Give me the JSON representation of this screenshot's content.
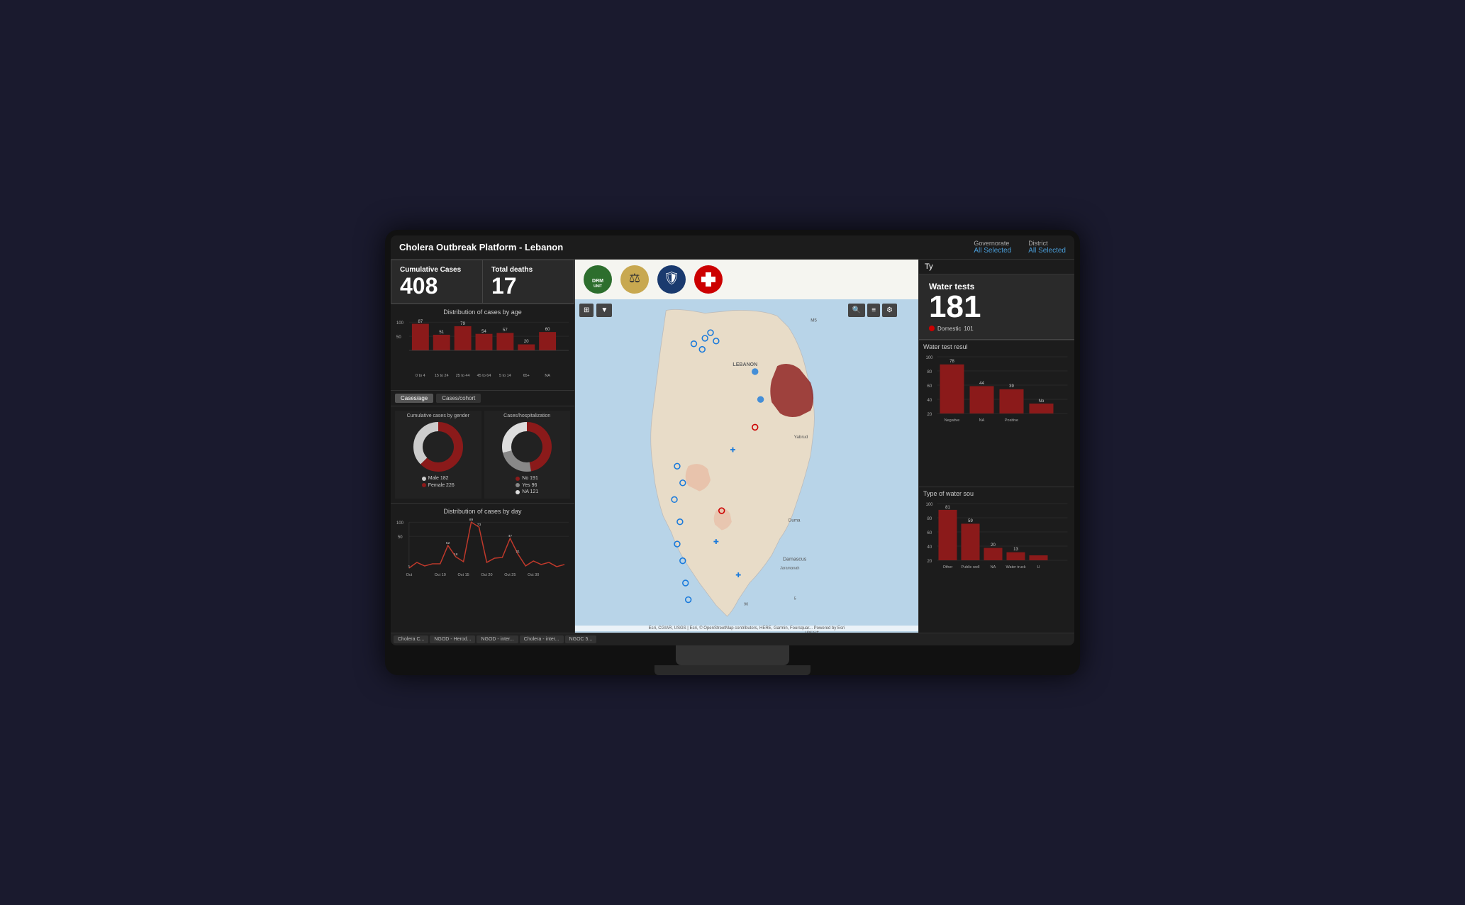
{
  "header": {
    "title": "Cholera Outbreak Platform - Lebanon",
    "filters": [
      {
        "label": "Governorate",
        "value": "All Selected"
      },
      {
        "label": "District",
        "value": "All Selected"
      }
    ]
  },
  "kpi": {
    "cumulative_label": "Cumulative Cases",
    "cumulative_value": "408",
    "deaths_label": "Total deaths",
    "deaths_value": "17"
  },
  "age_chart": {
    "title": "Distribution of cases by age",
    "bars": [
      {
        "label": "0 to 4",
        "value": 87,
        "pct": 87
      },
      {
        "label": "15 to 24",
        "value": 51,
        "pct": 51
      },
      {
        "label": "25 to 44",
        "value": 79,
        "pct": 79
      },
      {
        "label": "45 to 64",
        "value": 54,
        "pct": 54
      },
      {
        "label": "5 to 14",
        "value": 57,
        "pct": 57
      },
      {
        "label": "65+",
        "value": 20,
        "pct": 20
      },
      {
        "label": "NA",
        "value": 60,
        "pct": 60
      }
    ]
  },
  "tabs": [
    "Cases/age",
    "Cases/cohort"
  ],
  "gender_chart": {
    "title": "Cumulative cases by gender",
    "male": 182,
    "female": 226,
    "male_label": "Male 182",
    "female_label": "Female 226"
  },
  "hosp_chart": {
    "title": "Cases/hospitalization",
    "no": 191,
    "yes": 96,
    "na": 121,
    "no_label": "No 191",
    "yes_label": "Yes 96",
    "na_label": "NA 121"
  },
  "day_chart": {
    "title": "Distribution of cases by day",
    "points": [
      {
        "label": "Oct",
        "value": 1
      },
      {
        "label": "",
        "value": 10
      },
      {
        "label": "",
        "value": 4
      },
      {
        "label": "",
        "value": 7
      },
      {
        "label": "Oct 10",
        "value": 4
      },
      {
        "label": "",
        "value": 52
      },
      {
        "label": "",
        "value": 18
      },
      {
        "label": "Oct 15",
        "value": 9
      },
      {
        "label": "",
        "value": 89
      },
      {
        "label": "",
        "value": 73
      },
      {
        "label": "Oct 20",
        "value": 8
      },
      {
        "label": "",
        "value": 13
      },
      {
        "label": "",
        "value": 14
      },
      {
        "label": "Oct 25",
        "value": 47
      },
      {
        "label": "",
        "value": 21
      },
      {
        "label": "",
        "value": 4
      },
      {
        "label": "Oct 30",
        "value": 11
      },
      {
        "label": "",
        "value": 6
      },
      {
        "label": "",
        "value": 10
      },
      {
        "label": "",
        "value": 2
      },
      {
        "label": "",
        "value": 6
      }
    ]
  },
  "water_tests": {
    "label": "Water tests",
    "value": "181",
    "domestic_label": "Domestic",
    "domestic_value": "101"
  },
  "type_label": "Ty",
  "water_result": {
    "title": "Water test resul",
    "bars": [
      {
        "label": "Negative",
        "value": 78
      },
      {
        "label": "NA",
        "value": 44
      },
      {
        "label": "Positive",
        "value": 39
      },
      {
        "label": "No",
        "value": 15
      }
    ]
  },
  "water_source": {
    "title": "Type of water sou",
    "bars": [
      {
        "label": "Other",
        "value": 81
      },
      {
        "label": "Public well",
        "value": 59
      },
      {
        "label": "NA",
        "value": 20
      },
      {
        "label": "Water trucking",
        "value": 13
      },
      {
        "label": "U",
        "value": 8
      }
    ]
  },
  "map": {
    "attribution": "Esri, CGIAR, USGS | Esri, © OpenStreetMap contributors, HERE, Garmin, Foursquar... Powered by Esri"
  },
  "bottom_tabs": [
    "Cholera C...",
    "NGOD - Herod...",
    "NGOD - inter...",
    "Cholera - inter...",
    "NGOC 5..."
  ],
  "colors": {
    "crimson": "#8b1a1a",
    "dark_red": "#6b0a0a",
    "white": "#ffffff",
    "gray": "#888888",
    "accent_blue": "#4a9eda"
  }
}
